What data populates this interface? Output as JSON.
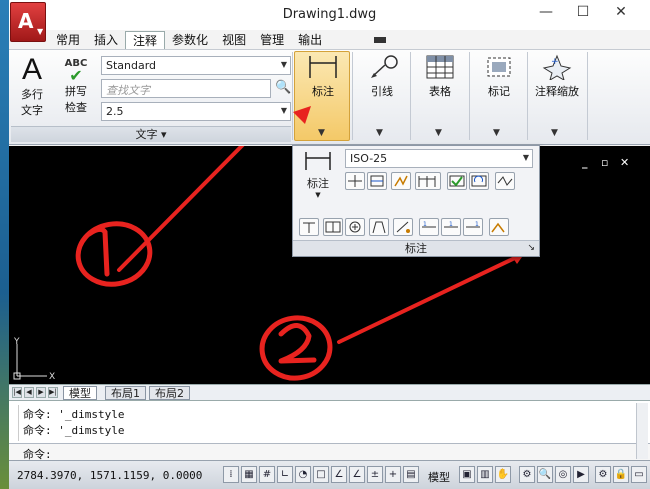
{
  "window": {
    "title": "Drawing1.dwg",
    "app_icon": "A",
    "controls": {
      "minimize": "—",
      "maximize": "☐",
      "close": "✕"
    }
  },
  "tabs": [
    "常用",
    "插入",
    "注释",
    "参数化",
    "视图",
    "管理",
    "输出"
  ],
  "active_tab": "注释",
  "ribbon": {
    "text_panel": {
      "mtext_line1": "多行",
      "mtext_line2": "文字",
      "spell_top": "ABC",
      "spell_line1": "拼写",
      "spell_line2": "检查",
      "style_value": "Standard",
      "find_placeholder": "查找文字",
      "height_value": "2.5",
      "panel_label": "文字 ▾"
    },
    "buttons": {
      "dimension": "标注",
      "leader": "引线",
      "table": "表格",
      "markup": "标记",
      "annoscale": "注释缩放"
    }
  },
  "popup": {
    "dimstyle_value": "ISO-25",
    "big_label": "标注",
    "footer": "标注"
  },
  "canvas": {
    "ucs_x": "X",
    "ucs_y": "Y",
    "annotations": [
      "1",
      "2"
    ],
    "controls": [
      "_",
      "▫",
      "✕"
    ]
  },
  "layout_tabs": [
    "模型",
    "布局1",
    "布局2"
  ],
  "command": {
    "lines": [
      "命令: '_dimstyle",
      "命令: '_dimstyle"
    ],
    "prompt": "命令:"
  },
  "status": {
    "coords": "2784.3970, 1571.1159, 0.0000",
    "model_label": "模型"
  },
  "colors": {
    "accent": "#f4c968",
    "annotation_red": "#e8231f"
  }
}
